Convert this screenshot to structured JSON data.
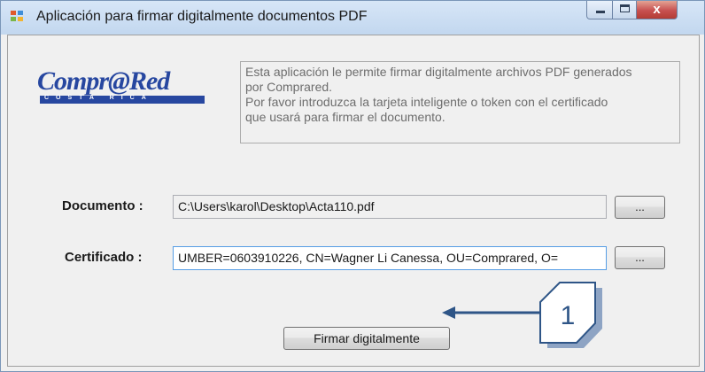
{
  "window": {
    "title": "Aplicación para firmar digitalmente documentos PDF",
    "controls": {
      "close_glyph": "x"
    }
  },
  "logo": {
    "brand": "Compr@Red",
    "subtitle": "COSTA RICA"
  },
  "info": {
    "line1": "Esta aplicación le permite firmar digitalmente archivos PDF generados",
    "line2": "por Comprared.",
    "line3": "Por favor introduzca la tarjeta inteligente o token con el certificado",
    "line4": "que usará para firmar el documento."
  },
  "form": {
    "document_label": "Documento :",
    "document_value": "C:\\Users\\karol\\Desktop\\Acta110.pdf",
    "certificate_label": "Certificado :",
    "certificate_value": "UMBER=0603910226, CN=Wagner Li Canessa, OU=Comprared, O=",
    "browse_label": "...",
    "sign_button": "Firmar digitalmente"
  },
  "annotation": {
    "callout_number": "1"
  },
  "colors": {
    "brand_blue": "#2747a0",
    "annotation_blue": "#2e5587",
    "field_focus_border": "#569de5"
  }
}
